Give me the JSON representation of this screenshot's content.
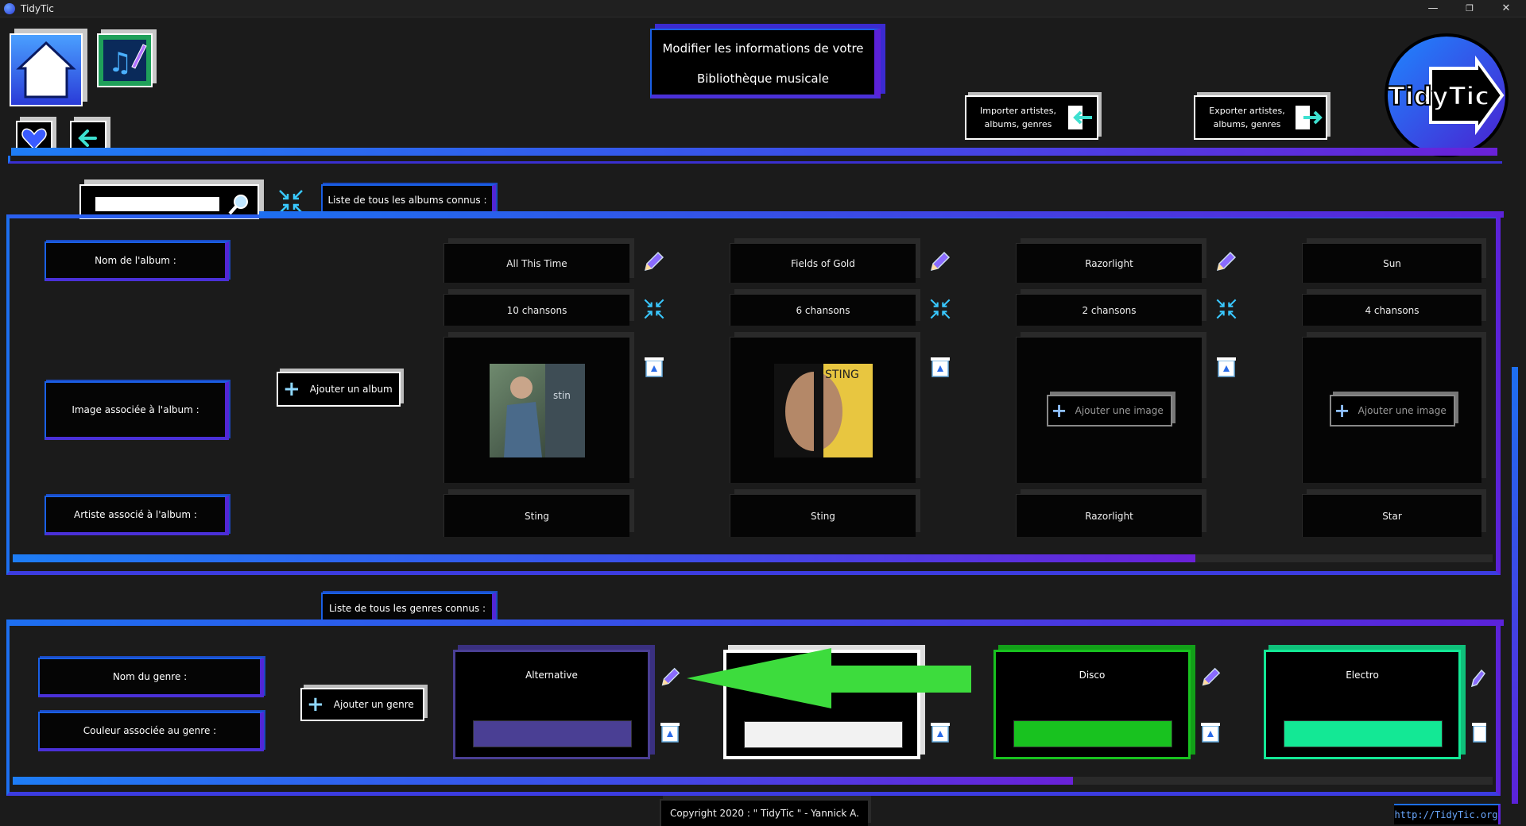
{
  "window": {
    "title": "TidyTic",
    "minimize": "—",
    "restore": "❐",
    "close": "✕"
  },
  "header": {
    "title_line1": "Modifier les informations de votre",
    "title_line2": "Bibliothèque musicale",
    "import_label": "Importer artistes, albums, genres",
    "export_label": "Exporter artistes, albums, genres",
    "logo_text": "TidyTic"
  },
  "albums": {
    "tab_label": "Liste de tous les albums connus :",
    "search_placeholder": "",
    "row_labels": {
      "name": "Nom de l'album :",
      "image": "Image associée à l'album :",
      "artist": "Artiste associé à l'album :"
    },
    "add_label": "Ajouter un album",
    "add_image_label": "Ajouter une image",
    "items": [
      {
        "name": "All This Time",
        "songs": "10 chansons",
        "artist": "Sting",
        "has_image": true
      },
      {
        "name": "Fields of Gold",
        "songs": "6 chansons",
        "artist": "Sting",
        "has_image": true
      },
      {
        "name": "Razorlight",
        "songs": "2 chansons",
        "artist": "Razorlight",
        "has_image": false
      },
      {
        "name": "Sun",
        "songs": "4 chansons",
        "artist": "Star",
        "has_image": false
      }
    ],
    "cover_text": [
      "stin",
      "STING"
    ]
  },
  "genres": {
    "tab_label": "Liste de tous les genres connus :",
    "row_labels": {
      "name": "Nom du genre :",
      "color": "Couleur associée au genre :"
    },
    "add_label": "Ajouter un genre",
    "items": [
      {
        "name": "Alternative",
        "color": "#4a3f94",
        "border": "#4a3f94"
      },
      {
        "name": "",
        "color": "#f2f2f2",
        "border": "#ffffff"
      },
      {
        "name": "Disco",
        "color": "#18c21f",
        "border": "#18c21f"
      },
      {
        "name": "Electro",
        "color": "#13e895",
        "border": "#13e895"
      }
    ]
  },
  "footer": {
    "copyright": "Copyright 2020 : \" TidyTic \" - Yannick A.",
    "link": "http://TidyTic.org"
  },
  "colors": {
    "accent_blue": "#1d6ff0",
    "accent_purple": "#5b22d9",
    "arrow_green": "#3ddc3d"
  }
}
